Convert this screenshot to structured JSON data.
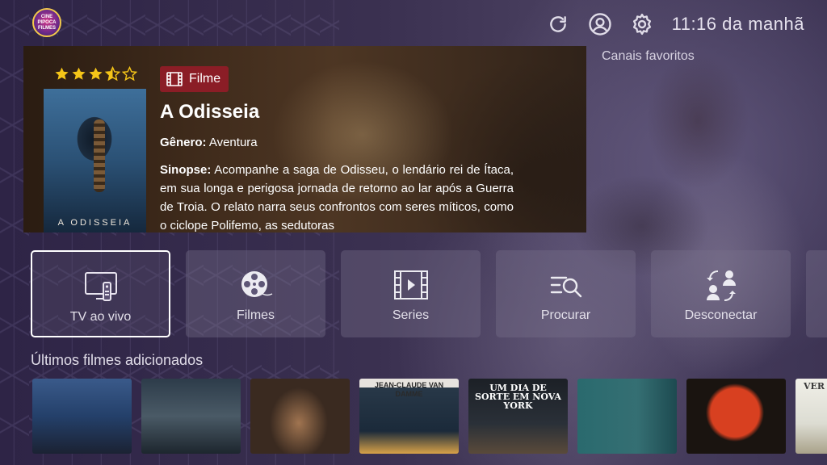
{
  "app": {
    "logo_text": [
      "CINE",
      "PIPOCA",
      "FILMES"
    ],
    "clock": "11:16 da manhã"
  },
  "topbar": {
    "icons": [
      "refresh-icon",
      "user-account-icon",
      "settings-gear-icon"
    ]
  },
  "favorites_label": "Canais favoritos",
  "hero": {
    "rating": 3.5,
    "rating_max": 5,
    "type_badge": "Filme",
    "title": "A Odisseia",
    "genre_label": "Gênero:",
    "genre_value": "Aventura",
    "synopsis_label": "Sinopse:",
    "synopsis_text": "Acompanhe a saga de Odisseu, o lendário rei de Ítaca, em sua longa e perigosa jornada de retorno ao lar após a Guerra de Troia. O relato narra seus confrontos com seres míticos, como o ciclope Polifemo, as sedutoras",
    "poster_title": "A ODISSEIA"
  },
  "menu": {
    "items": [
      {
        "label": "TV ao vivo",
        "icon": "live-tv-icon",
        "active": true
      },
      {
        "label": "Filmes",
        "icon": "film-reel-icon",
        "active": false
      },
      {
        "label": "Series",
        "icon": "series-play-icon",
        "active": false
      },
      {
        "label": "Procurar",
        "icon": "search-list-icon",
        "active": false
      },
      {
        "label": "Desconectar",
        "icon": "switch-user-icon",
        "active": false
      }
    ]
  },
  "latest": {
    "title": "Últimos filmes adicionados",
    "items": [
      {
        "caption": ""
      },
      {
        "caption": ""
      },
      {
        "caption": ""
      },
      {
        "caption": "JEAN-CLAUDE VAN DAMME"
      },
      {
        "caption": "UM DIA DE SORTE EM NOVA YORK"
      },
      {
        "caption": ""
      },
      {
        "caption": ""
      },
      {
        "caption": "VER"
      }
    ]
  },
  "colors": {
    "background": "#2e2446",
    "badge": "#8b1d26",
    "star": "#f5c518",
    "tile": "#78708c"
  }
}
